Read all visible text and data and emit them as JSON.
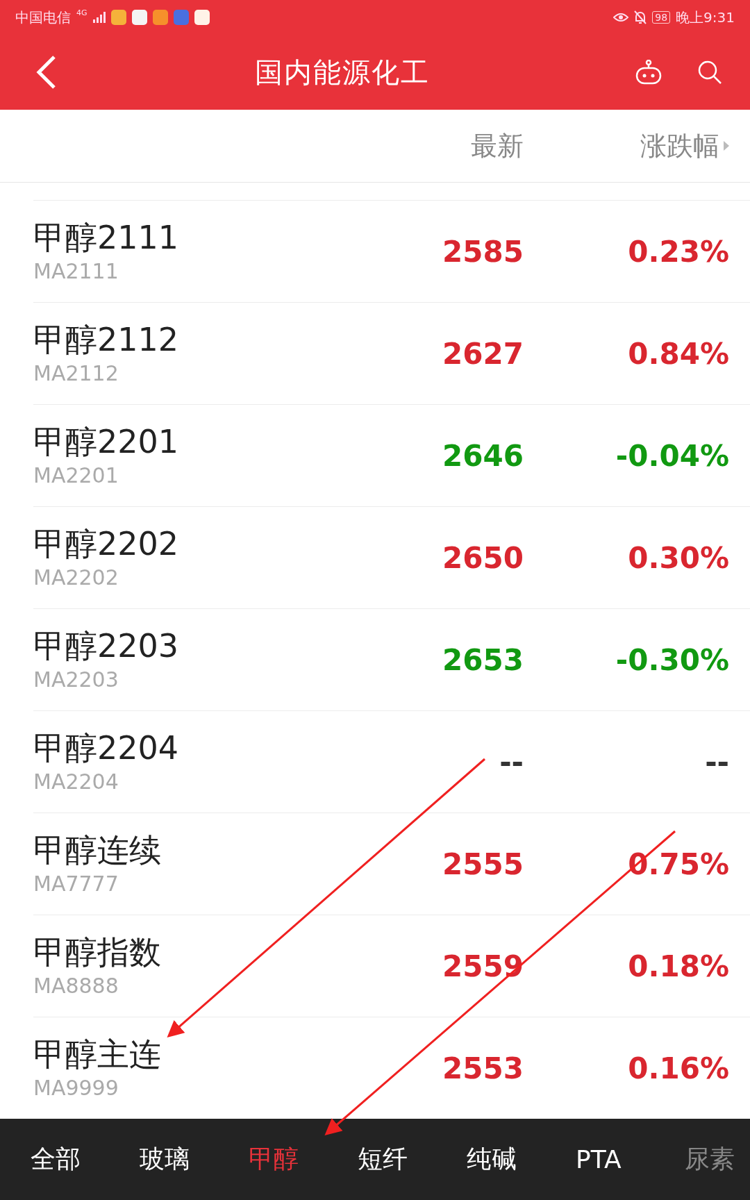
{
  "status_bar": {
    "carrier": "中国电信",
    "network": "4G",
    "battery": "98",
    "time": "晚上9:31"
  },
  "header": {
    "title": "国内能源化工"
  },
  "columns": [
    "最新",
    "涨跌幅"
  ],
  "rows": [
    {
      "name": "甲醇2111",
      "code": "MA2111",
      "price": "2585",
      "change": "0.23%",
      "kind": "up"
    },
    {
      "name": "甲醇2112",
      "code": "MA2112",
      "price": "2627",
      "change": "0.84%",
      "kind": "up"
    },
    {
      "name": "甲醇2201",
      "code": "MA2201",
      "price": "2646",
      "change": "-0.04%",
      "kind": "down"
    },
    {
      "name": "甲醇2202",
      "code": "MA2202",
      "price": "2650",
      "change": "0.30%",
      "kind": "up"
    },
    {
      "name": "甲醇2203",
      "code": "MA2203",
      "price": "2653",
      "change": "-0.30%",
      "kind": "down"
    },
    {
      "name": "甲醇2204",
      "code": "MA2204",
      "price": "--",
      "change": "--",
      "kind": "flat"
    },
    {
      "name": "甲醇连续",
      "code": "MA7777",
      "price": "2555",
      "change": "0.75%",
      "kind": "up"
    },
    {
      "name": "甲醇指数",
      "code": "MA8888",
      "price": "2559",
      "change": "0.18%",
      "kind": "up"
    },
    {
      "name": "甲醇主连",
      "code": "MA9999",
      "price": "2553",
      "change": "0.16%",
      "kind": "up"
    }
  ],
  "tabs": [
    {
      "label": "全部",
      "selected": false
    },
    {
      "label": "玻璃",
      "selected": false
    },
    {
      "label": "甲醇",
      "selected": true
    },
    {
      "label": "短纤",
      "selected": false
    },
    {
      "label": "纯碱",
      "selected": false
    },
    {
      "label": "PTA",
      "selected": false
    },
    {
      "label": "尿素",
      "selected": false
    }
  ],
  "annotation_arrows": [
    {
      "kind": "arrow"
    },
    {
      "kind": "arrow"
    }
  ]
}
